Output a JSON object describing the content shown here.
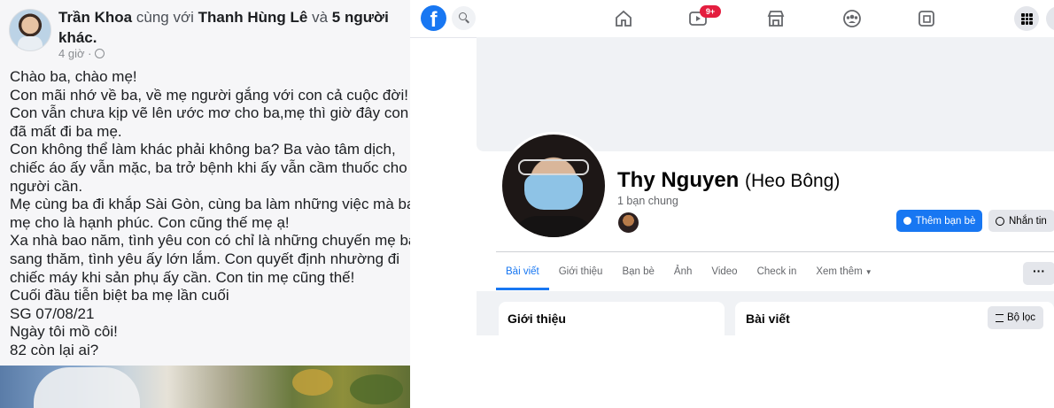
{
  "post": {
    "author": "Trần Khoa",
    "with_text": "cùng với",
    "tagged_name": "Thanh Hùng Lê",
    "and_text": "và",
    "others_line1": "5 người",
    "others_line2": "khác.",
    "time": "4 giờ ·",
    "body_lines": [
      "Chào ba, chào mẹ!",
      "Con mãi nhớ về ba, về mẹ người gắng với con cả cuộc đời!",
      "Con vẫn chưa kịp vẽ lên ước mơ cho ba,mẹ thì giờ đây con",
      "đã mất đi ba mẹ.",
      "Con không thể làm khác phải không ba? Ba vào tâm dịch,",
      "chiếc áo ấy vẫn mặc, ba trở bệnh khi ấy vẫn cầm thuốc cho",
      "người cần.",
      "Mẹ cùng ba đi khắp Sài Gòn, cùng ba làm những việc mà ba",
      "mẹ cho là hạnh phúc. Con cũng thế mẹ ạ!",
      "Xa nhà bao năm, tình yêu con có chỉ là những chuyến mẹ ba",
      "sang thăm, tình yêu ấy lớn lắm. Con quyết định nhường đi",
      "chiếc máy khi sản phụ ấy cần. Con tin mẹ cũng thế!",
      "Cuối đầu tiễn biệt ba mẹ lần cuối",
      "SG 07/08/21",
      "Ngày tôi mồ côi!",
      "82 còn lại ai?"
    ]
  },
  "profile": {
    "logo": "f",
    "notification_badge": "9+",
    "name": "Thy Nguyen",
    "nickname": "(Heo Bông)",
    "mutual_friends": "1 bạn chung",
    "add_friend_label": "Thêm bạn bè",
    "message_label": "Nhắn tin",
    "tabs": [
      {
        "label": "Bài viết",
        "active": true
      },
      {
        "label": "Giới thiệu",
        "active": false
      },
      {
        "label": "Bạn bè",
        "active": false
      },
      {
        "label": "Ảnh",
        "active": false
      },
      {
        "label": "Video",
        "active": false
      },
      {
        "label": "Check in",
        "active": false
      },
      {
        "label": "Xem thêm",
        "active": false
      }
    ],
    "more_options": "···",
    "intro_title": "Giới thiệu",
    "posts_title": "Bài viết",
    "filter_label": "Bộ lọc"
  },
  "colors": {
    "brand": "#1877f2",
    "badge": "#e41e3f",
    "muted": "#65676b"
  },
  "icons": [
    "globe-icon",
    "facebook-logo-icon",
    "search-icon",
    "home-icon",
    "watch-icon",
    "marketplace-icon",
    "groups-icon",
    "gaming-icon",
    "menu-grid-icon",
    "add-friend-icon",
    "messenger-icon",
    "filter-icon",
    "caret-down-icon"
  ]
}
